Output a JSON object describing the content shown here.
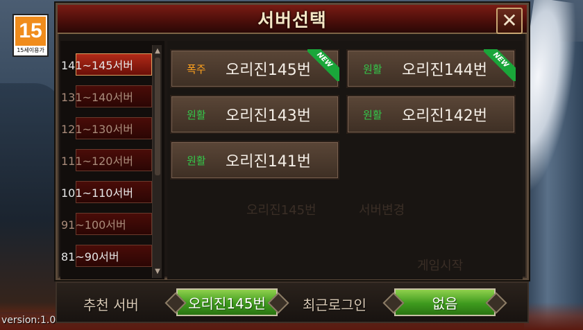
{
  "app": {
    "version": "version:1.0",
    "age_badge": {
      "number": "15",
      "label": "15세이용가"
    }
  },
  "dialog": {
    "title": "서버선택",
    "close_icon": "close-x-icon"
  },
  "server_groups": [
    {
      "label": "141~145서버",
      "active": true
    },
    {
      "label": "131~140서버",
      "active": false
    },
    {
      "label": "121~130서버",
      "active": false
    },
    {
      "label": "111~120서버",
      "active": false
    },
    {
      "label": "101~110서버",
      "active": false
    },
    {
      "label": "91~100서버",
      "active": false
    },
    {
      "label": "81~90서버",
      "active": false
    }
  ],
  "servers": [
    {
      "status": "폭주",
      "name": "오리진145번",
      "is_new": true,
      "badge": "NEW"
    },
    {
      "status": "원활",
      "name": "오리진144번",
      "is_new": true,
      "badge": "NEW"
    },
    {
      "status": "원활",
      "name": "오리진143번",
      "is_new": false
    },
    {
      "status": "원활",
      "name": "오리진142번",
      "is_new": false
    },
    {
      "status": "원활",
      "name": "오리진141번",
      "is_new": false
    }
  ],
  "background_ghosts": {
    "server_name": "오리진145번",
    "server_change": "서버변경",
    "game_start": "게임시작"
  },
  "bottom": {
    "recommended_label": "추천 서버",
    "recommended_value": "오리진145번",
    "recent_label": "최근로그인",
    "recent_value": "없음"
  },
  "colors": {
    "status_hot": "#ffa21d",
    "status_ok": "#34c84a",
    "accent_red": "#7a1c14",
    "button_green": "#3e9a1e"
  }
}
